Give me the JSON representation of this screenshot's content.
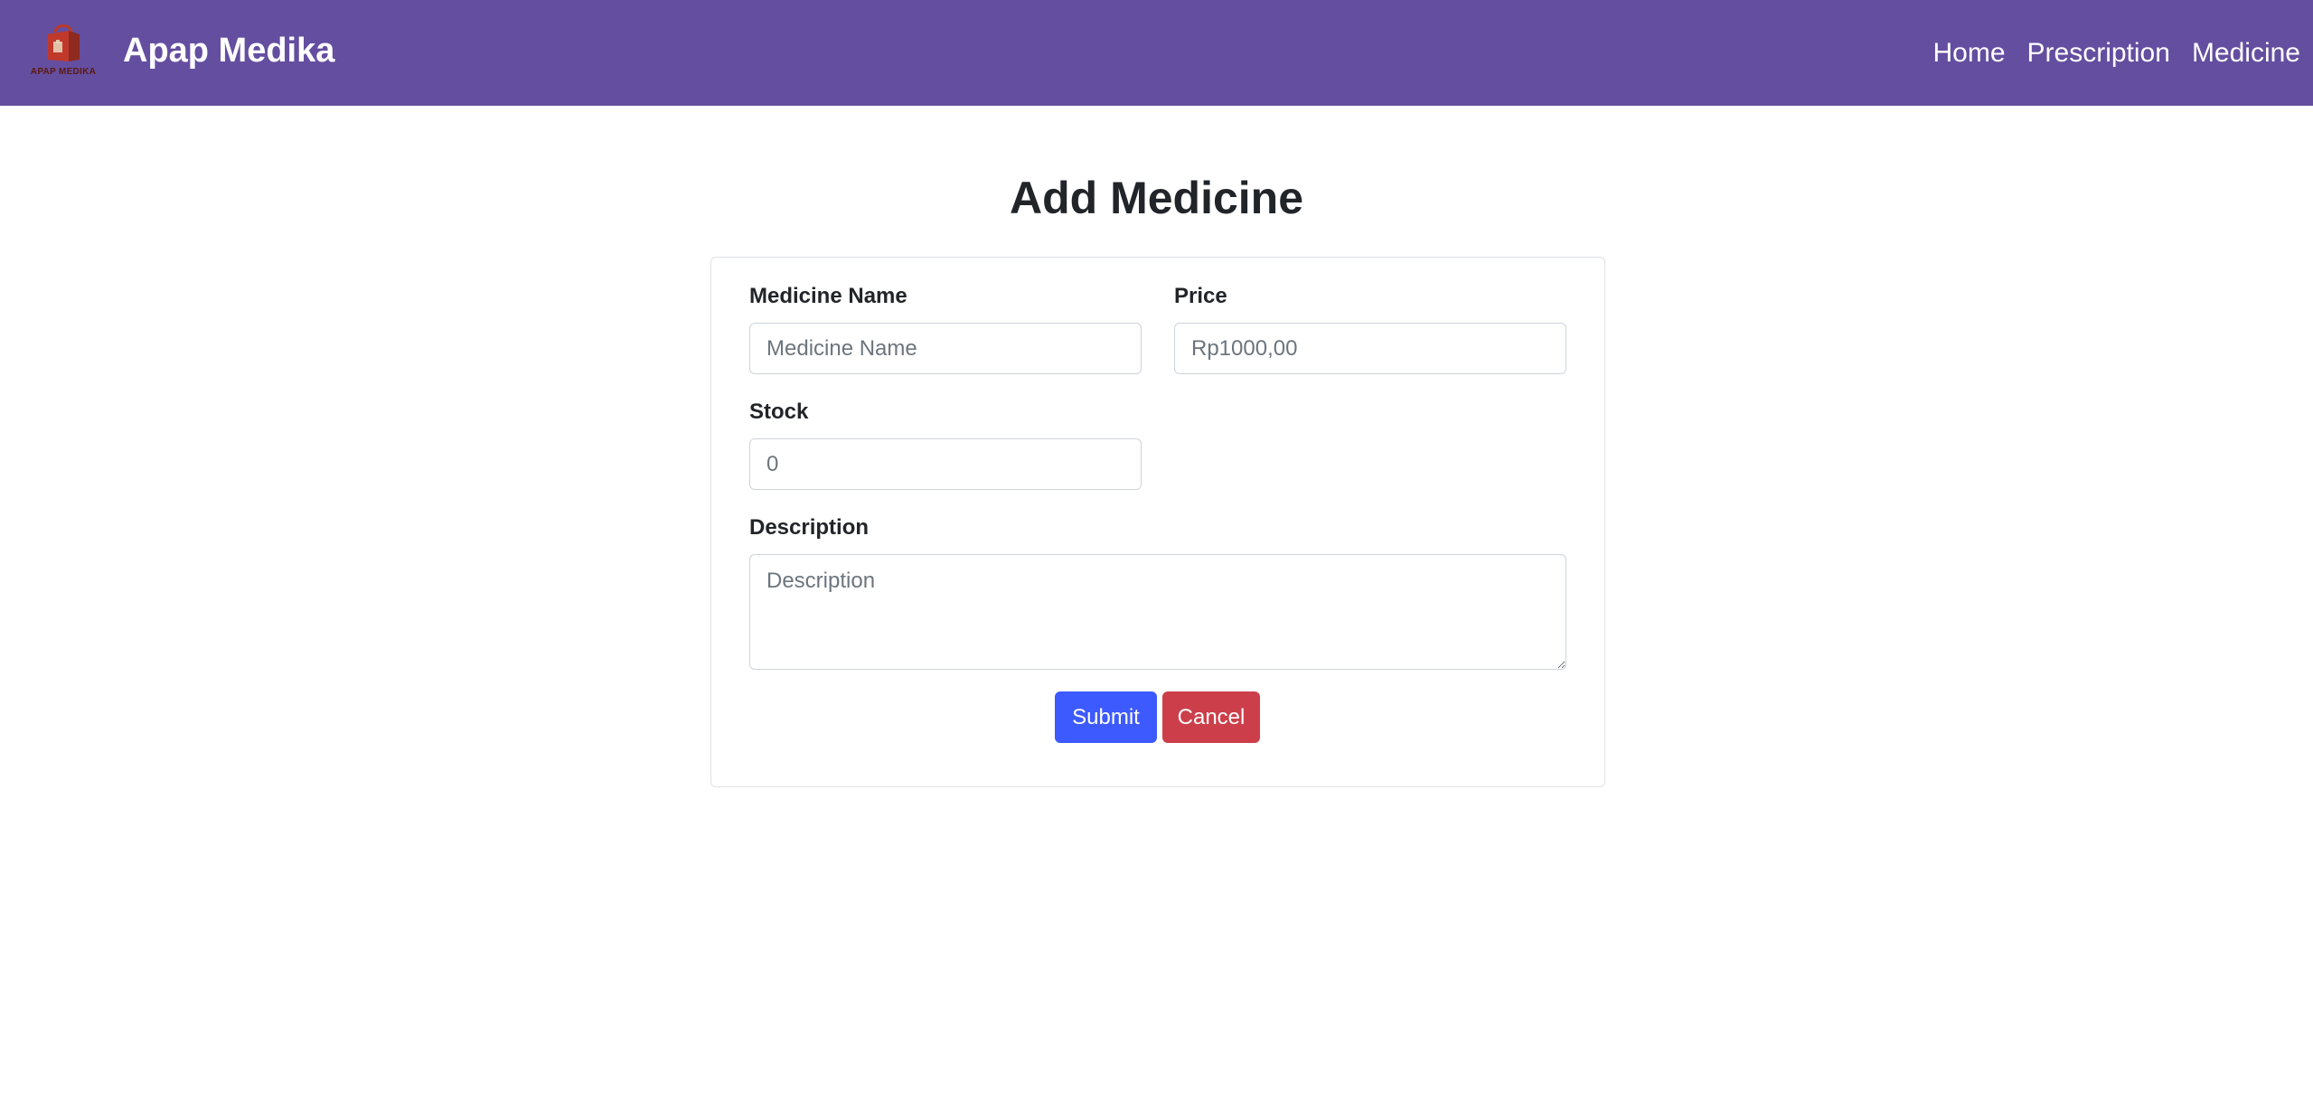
{
  "navbar": {
    "logo_icon": "shopping-bag-logo",
    "logo_text": "APAP MEDIKA",
    "brand": "Apap Medika",
    "links": [
      {
        "label": "Home"
      },
      {
        "label": "Prescription"
      },
      {
        "label": "Medicine"
      }
    ]
  },
  "page": {
    "title": "Add Medicine"
  },
  "form": {
    "medicine_name": {
      "label": "Medicine Name",
      "placeholder": "Medicine Name",
      "value": ""
    },
    "price": {
      "label": "Price",
      "placeholder": "Rp1000,00",
      "value": ""
    },
    "stock": {
      "label": "Stock",
      "placeholder": "0",
      "value": ""
    },
    "description": {
      "label": "Description",
      "placeholder": "Description",
      "value": ""
    },
    "submit_label": "Submit",
    "cancel_label": "Cancel"
  },
  "colors": {
    "navbar_bg": "#644ea0",
    "submit_bg": "#3d5afe",
    "cancel_bg": "#cc3f4a"
  }
}
